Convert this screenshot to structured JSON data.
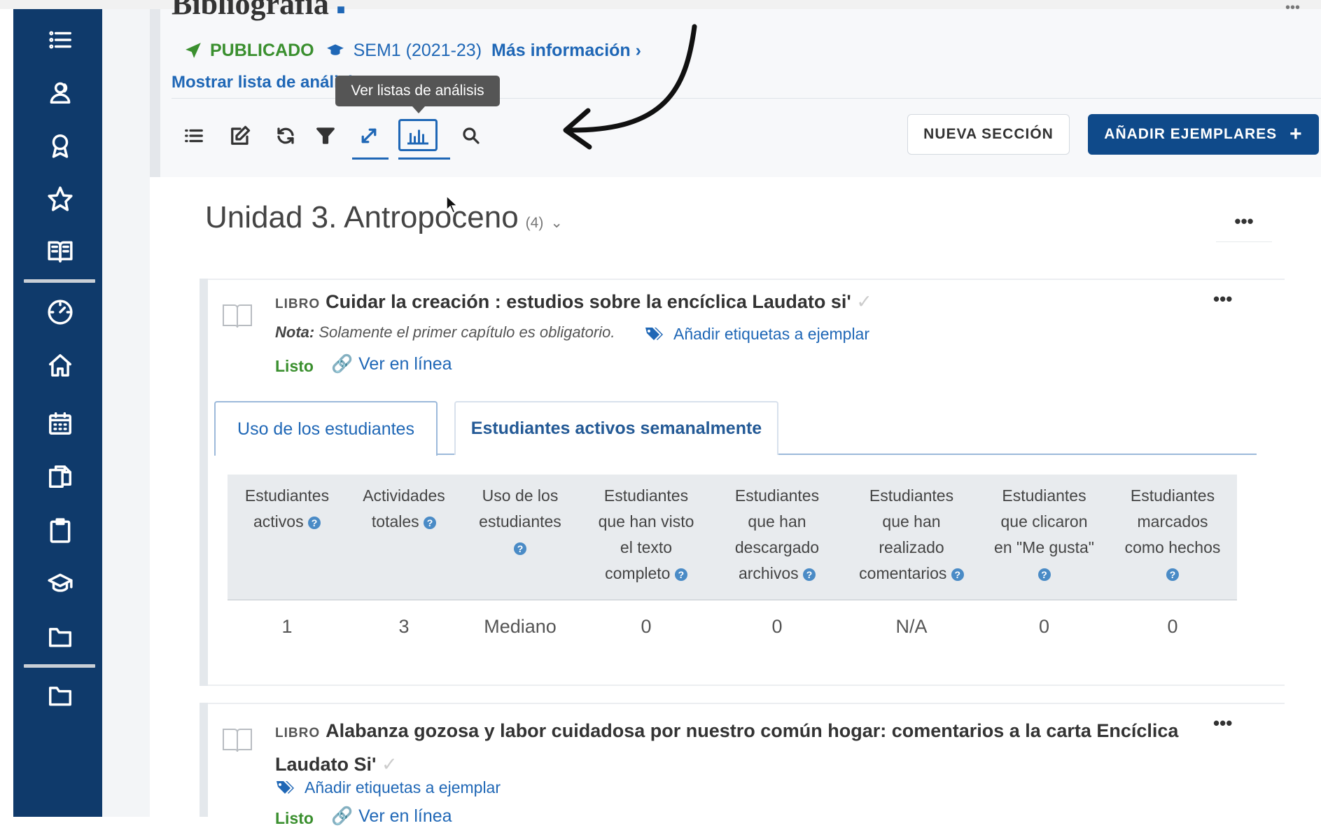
{
  "header": {
    "title_cut": "Bibliografía",
    "status_published": "PUBLICADO",
    "semester": "SEM1 (2021-23)",
    "more_info": "Más información ›",
    "show_list": "Mostrar lista de análisis",
    "tooltip": "Ver listas de análisis",
    "new_section_button": "NUEVA SECCIÓN",
    "add_items_button": "AÑADIR EJEMPLARES",
    "add_items_plus": "+"
  },
  "colors": {
    "sidebar": "#0f3a6b",
    "link_blue": "#1f67b6",
    "status_green": "#3a8f2e",
    "primary_button": "#0f4a8a"
  },
  "sidebar": {
    "icons": [
      "list-icon",
      "users-icon",
      "award-icon",
      "star-icon",
      "book-open-icon",
      "gauge-icon",
      "home-icon",
      "calendar-icon",
      "documents-icon",
      "clipboard-icon",
      "graduation-cap-icon",
      "folder-icon",
      "folder-icon"
    ]
  },
  "toolbar": {
    "icons": [
      "list-icon",
      "edit-icon",
      "refresh-icon",
      "filter-icon",
      "expand-icon",
      "bar-chart-icon",
      "search-icon"
    ]
  },
  "unit": {
    "title": "Unidad 3. Antropoceno",
    "count": "(4)",
    "menu": "•••"
  },
  "items": [
    {
      "type": "LIBRO",
      "title": "Cuidar la creación : estudios sobre la encíclica Laudato si'",
      "note_label": "Nota:",
      "note_text": "Solamente el primer capítulo es obligatorio.",
      "tag_link": "Añadir etiquetas a ejemplar",
      "status": "Listo",
      "online_link": "Ver en línea",
      "menu": "•••"
    },
    {
      "type": "LIBRO",
      "title_line1": "Alabanza gozosa y labor cuidadosa por nuestro común hogar: comentarios a la carta Encíclica",
      "title_line2": "Laudato Si'",
      "tag_link": "Añadir etiquetas a ejemplar",
      "status": "Listo",
      "online_link": "Ver en línea",
      "menu": "•••"
    }
  ],
  "tabs": [
    "Uso de los estudiantes",
    "Estudiantes activos semanalmente"
  ],
  "table": {
    "headers": [
      [
        "Estudiantes",
        "activos"
      ],
      [
        "Actividades",
        "totales"
      ],
      [
        "Uso de los",
        "estudiantes",
        ""
      ],
      [
        "Estudiantes",
        "que han visto",
        "el texto",
        "completo"
      ],
      [
        "Estudiantes",
        "que han",
        "descargado",
        "archivos"
      ],
      [
        "Estudiantes",
        "que han",
        "realizado",
        "comentarios"
      ],
      [
        "Estudiantes",
        "que clicaron",
        "en \"Me gusta\"",
        ""
      ],
      [
        "Estudiantes",
        "marcados",
        "como hechos",
        ""
      ]
    ],
    "help_glyph": "?",
    "row": [
      "1",
      "3",
      "Mediano",
      "0",
      "0",
      "N/A",
      "0",
      "0"
    ]
  }
}
